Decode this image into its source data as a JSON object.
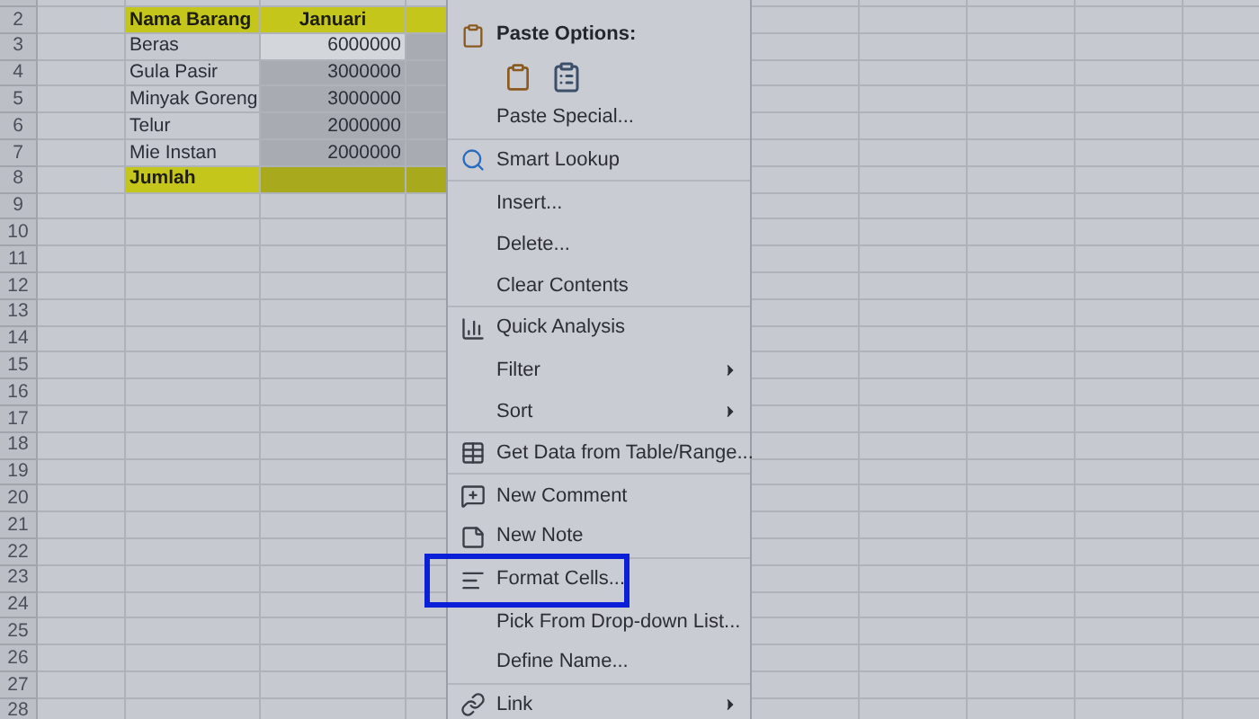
{
  "row_numbers": [
    "2",
    "3",
    "4",
    "5",
    "6",
    "7",
    "8",
    "9",
    "10",
    "11",
    "12",
    "13",
    "14",
    "15",
    "16",
    "17",
    "18",
    "19",
    "20",
    "21",
    "22",
    "23",
    "24",
    "25",
    "26",
    "27",
    "28"
  ],
  "table": {
    "header": [
      "Nama Barang",
      "Januari"
    ],
    "rows": [
      {
        "item": "Beras",
        "value": "6000000",
        "active": true
      },
      {
        "item": "Gula Pasir",
        "value": "3000000",
        "active": false
      },
      {
        "item": "Minyak Goreng",
        "value": "3000000",
        "active": false
      },
      {
        "item": "Telur",
        "value": "2000000",
        "active": false
      },
      {
        "item": "Mie Instan",
        "value": "2000000",
        "active": false
      }
    ],
    "total_label": "Jumlah"
  },
  "context_menu": {
    "items": [
      {
        "kind": "header",
        "label": "Paste Options:"
      },
      {
        "kind": "paste_icons"
      },
      {
        "kind": "item",
        "label": "Paste Special...",
        "submenu": false,
        "separator_after": true
      },
      {
        "kind": "item",
        "label": "Smart Lookup",
        "submenu": false,
        "separator_after": true
      },
      {
        "kind": "item",
        "label": "Insert...",
        "submenu": false,
        "separator_after": false
      },
      {
        "kind": "item",
        "label": "Delete...",
        "submenu": false,
        "separator_after": false
      },
      {
        "kind": "item",
        "label": "Clear Contents",
        "submenu": false,
        "separator_after": true
      },
      {
        "kind": "item",
        "label": "Quick Analysis",
        "submenu": false,
        "separator_after": false
      },
      {
        "kind": "item",
        "label": "Filter",
        "submenu": true,
        "separator_after": false
      },
      {
        "kind": "item",
        "label": "Sort",
        "submenu": true,
        "separator_after": true
      },
      {
        "kind": "item",
        "label": "Get Data from Table/Range...",
        "submenu": false,
        "separator_after": true
      },
      {
        "kind": "item",
        "label": "New Comment",
        "submenu": false,
        "separator_after": false
      },
      {
        "kind": "item",
        "label": "New Note",
        "submenu": false,
        "separator_after": true
      },
      {
        "kind": "item",
        "label": "Format Cells...",
        "submenu": false,
        "separator_after": false
      },
      {
        "kind": "item",
        "label": "Pick From Drop-down List...",
        "submenu": false,
        "separator_after": false
      },
      {
        "kind": "item",
        "label": "Define Name...",
        "submenu": false,
        "separator_after": true
      },
      {
        "kind": "item",
        "label": "Link",
        "submenu": true,
        "separator_after": false
      }
    ]
  }
}
